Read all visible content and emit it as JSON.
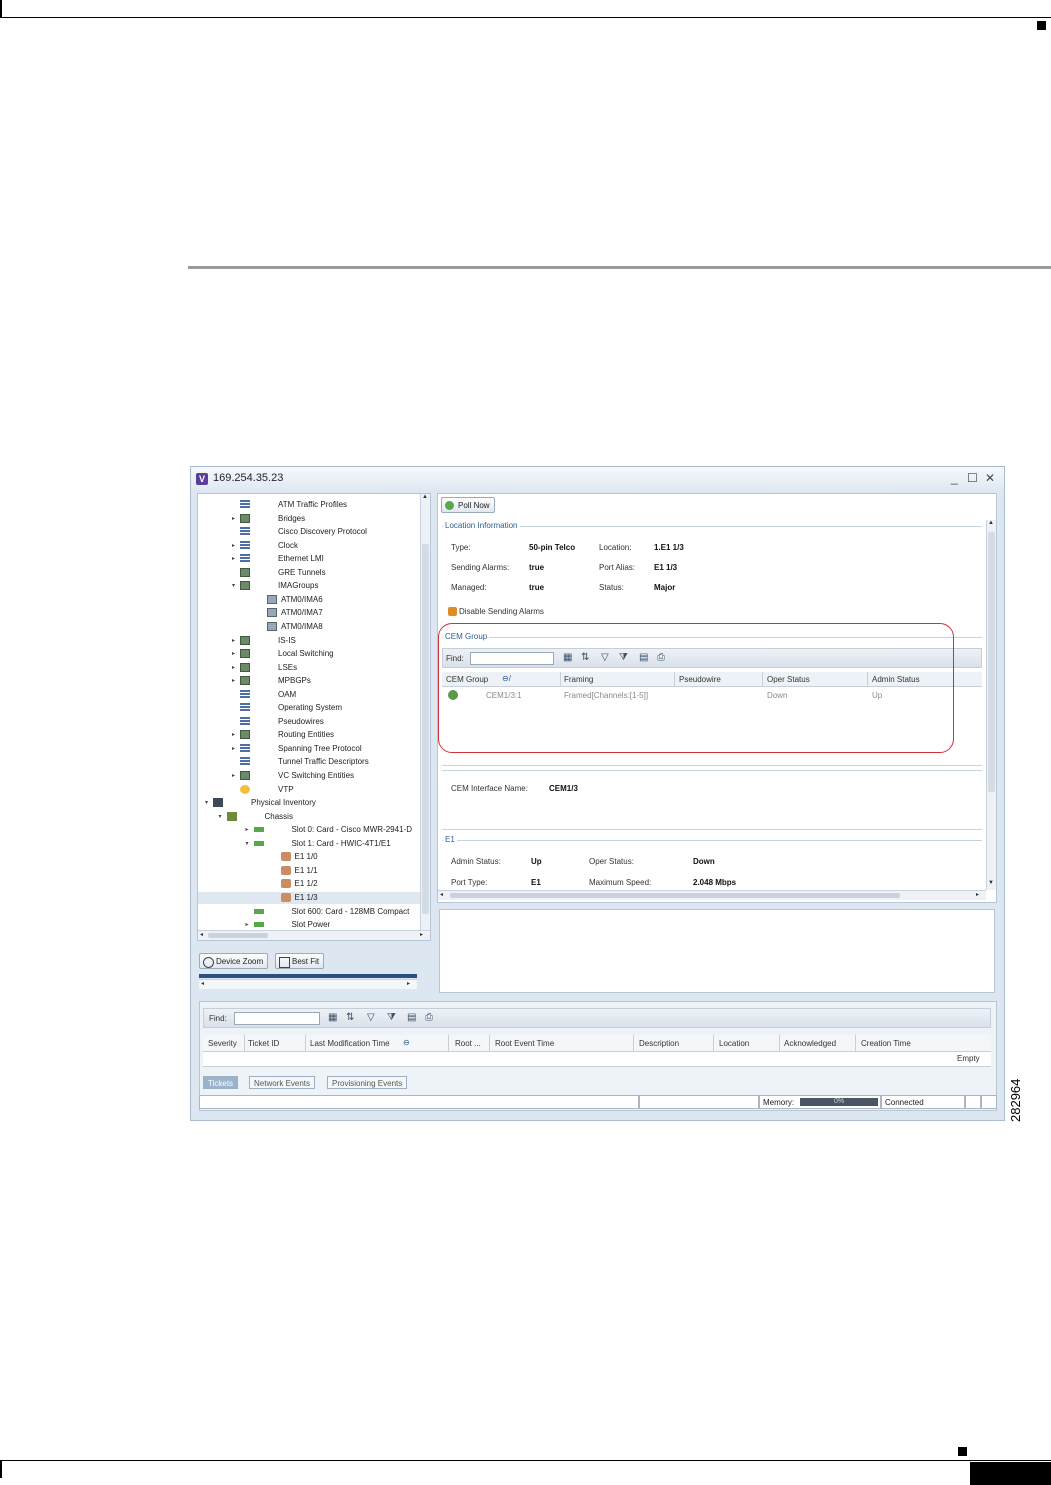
{
  "figure_id": "282964",
  "window": {
    "title": "169.254.35.23",
    "controls": [
      "_",
      "☐",
      "✕"
    ]
  },
  "tree": {
    "items": [
      {
        "label": "ATM Traffic Profiles",
        "icon": "list-icon"
      },
      {
        "label": "Bridges",
        "icon": "group-icon"
      },
      {
        "label": "Cisco Discovery Protocol",
        "icon": "list-icon"
      },
      {
        "label": "Clock",
        "icon": "list-icon"
      },
      {
        "label": "Ethernet LMI",
        "icon": "list-icon"
      },
      {
        "label": "GRE Tunnels",
        "icon": "group-icon"
      },
      {
        "label": "IMAGroups",
        "icon": "group-icon"
      },
      {
        "label": "ATM0/IMA6",
        "icon": "atm-icon"
      },
      {
        "label": "ATM0/IMA7",
        "icon": "atm-icon"
      },
      {
        "label": "ATM0/IMA8",
        "icon": "atm-icon"
      },
      {
        "label": "IS-IS",
        "icon": "group-icon"
      },
      {
        "label": "Local Switching",
        "icon": "group-icon"
      },
      {
        "label": "LSEs",
        "icon": "group-icon"
      },
      {
        "label": "MPBGPs",
        "icon": "group-icon"
      },
      {
        "label": "OAM",
        "icon": "list-icon"
      },
      {
        "label": "Operating System",
        "icon": "list-icon"
      },
      {
        "label": "Pseudowires",
        "icon": "list-icon"
      },
      {
        "label": "Routing Entities",
        "icon": "group-icon"
      },
      {
        "label": "Spanning Tree Protocol",
        "icon": "list-icon"
      },
      {
        "label": "Tunnel Traffic Descriptors",
        "icon": "list-icon"
      },
      {
        "label": "VC Switching Entities",
        "icon": "group-icon"
      },
      {
        "label": "VTP",
        "icon": "vtp-icon"
      },
      {
        "label": "Physical Inventory",
        "icon": "physical-inventory-icon"
      },
      {
        "label": "Chassis",
        "icon": "chassis-icon"
      },
      {
        "label": "Slot 0: Card - Cisco MWR-2941-D",
        "icon": "card-icon"
      },
      {
        "label": "Slot 1: Card - HWIC-4T1/E1",
        "icon": "card-icon"
      },
      {
        "label": "E1 1/0",
        "icon": "port-icon"
      },
      {
        "label": "E1 1/1",
        "icon": "port-icon"
      },
      {
        "label": "E1 1/2",
        "icon": "port-icon"
      },
      {
        "label": "E1 1/3",
        "icon": "port-icon"
      },
      {
        "label": "Slot 600: Card - 128MB Compact",
        "icon": "card-icon"
      },
      {
        "label": "Slot Power",
        "icon": "card-icon"
      }
    ]
  },
  "left_buttons": {
    "device_zoom": "Device Zoom",
    "best_fit": "Best Fit"
  },
  "details": {
    "poll_now": "Poll Now",
    "location_section": "Location Information",
    "type_label": "Type:",
    "type_value": "50-pin Telco",
    "location_label": "Location:",
    "location_value": "1.E1 1/3",
    "sending_alarms_label": "Sending Alarms:",
    "sending_alarms_value": "true",
    "port_alias_label": "Port Alias:",
    "port_alias_value": "E1 1/3",
    "managed_label": "Managed:",
    "managed_value": "true",
    "status_label": "Status:",
    "status_value": "Major",
    "disable_alarms": "Disable Sending Alarms",
    "cem_section": "CEM Group",
    "find_label": "Find:",
    "cem_columns": [
      "CEM Group",
      "Framing",
      "Pseudowire",
      "Oper Status",
      "Admin Status"
    ],
    "cem_rows": [
      {
        "cem_group": "CEM1/3:1",
        "framing": "Framed[Channels:[1-5]]",
        "pseudowire": "",
        "oper_status": "Down",
        "admin_status": "Up"
      }
    ],
    "cem_if_label": "CEM Interface Name:",
    "cem_if_value": "CEM1/3",
    "e1_section": "E1",
    "admin_status_label": "Admin Status:",
    "admin_status_value": "Up",
    "oper_status_label": "Oper Status:",
    "oper_status_value": "Down",
    "port_type_label": "Port Type:",
    "port_type_value": "E1",
    "max_speed_label": "Maximum Speed:",
    "max_speed_value": "2.048 Mbps"
  },
  "tickets": {
    "find_label": "Find:",
    "columns": [
      "Severity",
      "Ticket ID",
      "Last Modification Time",
      "Root ...",
      "Root Event Time",
      "Description",
      "Location",
      "Acknowledged",
      "Creation Time"
    ],
    "empty_label": "Empty",
    "tabs": [
      "Tickets",
      "Network Events",
      "Provisioning Events"
    ]
  },
  "statusbar": {
    "memory_label": "Memory:",
    "memory_value": "0%",
    "connection": "Connected"
  },
  "colors": {
    "highlight": "#d0303a",
    "link": "#2c5d99"
  }
}
